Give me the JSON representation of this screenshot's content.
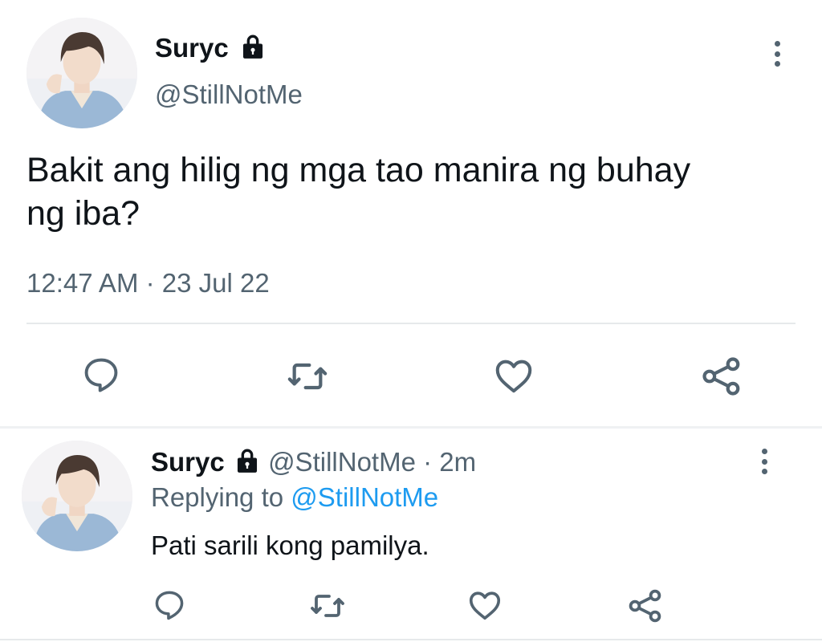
{
  "main_tweet": {
    "display_name": "Suryc",
    "handle": "@StillNotMe",
    "text_line1": "Bakit ang hilig ng mga tao manira ng buhay",
    "text_line2": "ng iba?",
    "time": "12:47 AM",
    "separator": "·",
    "date": "23 Jul 22",
    "actions": [
      "reply-icon",
      "retweet-icon",
      "like-icon",
      "share-icon"
    ]
  },
  "reply_tweet": {
    "display_name": "Suryc",
    "handle": "@StillNotMe",
    "separator": "·",
    "age": "2m",
    "replying_to_label": "Replying to",
    "replying_to_handle": "@StillNotMe",
    "text": "Pati sarili kong pamilya.",
    "actions": [
      "reply-icon",
      "retweet-icon",
      "like-icon",
      "share-icon"
    ]
  },
  "colors": {
    "text": "#0f1419",
    "muted": "#536471",
    "link": "#1d9bf0",
    "divider": "#e6e9eb"
  }
}
